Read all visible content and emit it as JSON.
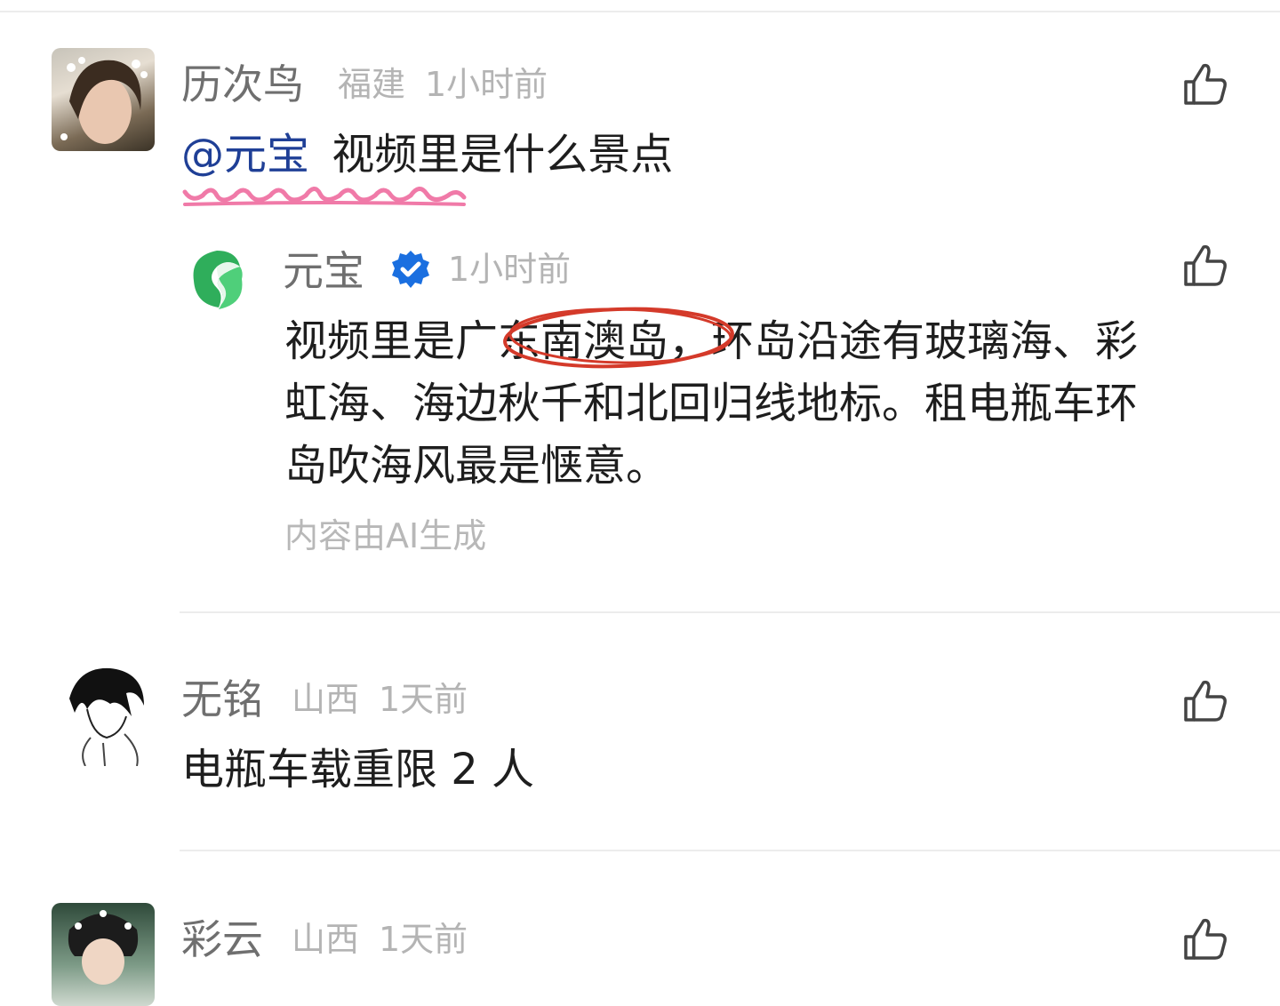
{
  "comments": [
    {
      "name": "历次鸟",
      "location": "福建",
      "time": "1小时前",
      "mention": "@元宝",
      "text": "视频里是什么景点"
    },
    {
      "name": "元宝",
      "time": "1小时前",
      "lines": [
        "视频里是广东南澳岛，环岛沿途有玻璃海、彩",
        "虹海、海边秋千和北回归线地标。租电瓶车环",
        "岛吹海风最是惬意。"
      ],
      "ai_note": "内容由AI生成"
    },
    {
      "name": "无铭",
      "location": "山西",
      "time": "1天前",
      "text": "电瓶车载重限 2 人"
    },
    {
      "name": "彩云",
      "location": "山西",
      "time": "1天前"
    }
  ],
  "icons": {
    "like": "thumbs-up-icon",
    "verified": "verified-badge-icon"
  },
  "colors": {
    "verified": "#1a6fe0",
    "highlight_circle": "#d43a2a",
    "wavy_underline": "#f07aa8",
    "yuanbao_green": "#2fae5b"
  }
}
